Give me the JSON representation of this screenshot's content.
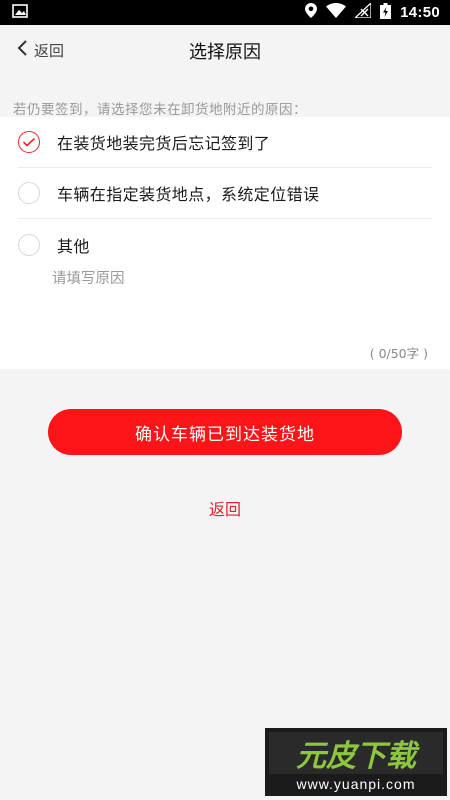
{
  "status_bar": {
    "time": "14:50",
    "icons": [
      "image-icon",
      "location-icon",
      "wifi-icon",
      "no-signal-icon",
      "battery-charging-icon"
    ]
  },
  "header": {
    "back_label": "返回",
    "title": "选择原因"
  },
  "prompt": "若仍要签到，请选择您未在卸货地附近的原因：",
  "options": [
    {
      "label": "在装货地装完货后忘记签到了",
      "selected": true
    },
    {
      "label": "车辆在指定装货地点，系统定位错误",
      "selected": false
    },
    {
      "label": "其他",
      "selected": false
    }
  ],
  "reason_input": {
    "placeholder": "请填写原因",
    "value": ""
  },
  "char_count": "( 0/50字 )",
  "confirm_button": "确认车辆已到达装货地",
  "return_link": "返回",
  "watermark": {
    "brand": "元皮下载",
    "url": "www.yuanpi.com"
  },
  "colors": {
    "accent": "#fc1418",
    "link": "#d9262b",
    "background": "#f4f4f4"
  }
}
